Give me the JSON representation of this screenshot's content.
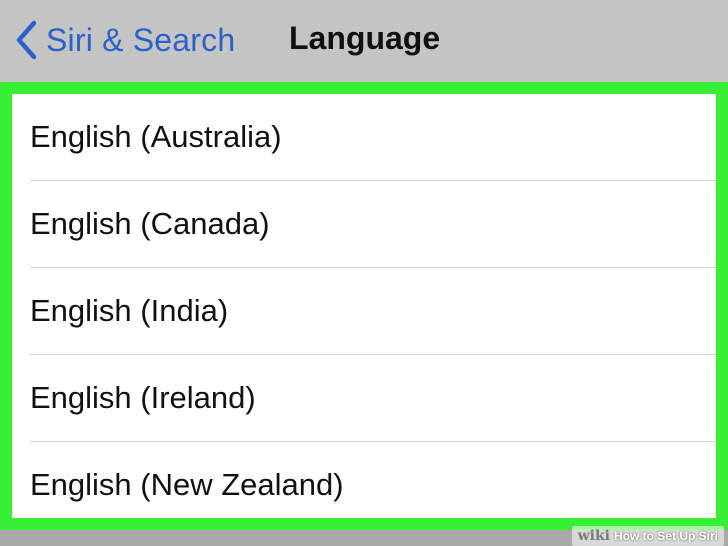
{
  "navbar": {
    "back_label": "Siri & Search",
    "title": "Language",
    "back_icon": "chevron-left-icon",
    "accent_color": "#2a62c9"
  },
  "languages": [
    {
      "label": "English (Australia)"
    },
    {
      "label": "English (Canada)"
    },
    {
      "label": "English (India)"
    },
    {
      "label": "English (Ireland)"
    },
    {
      "label": "English (New Zealand)"
    }
  ],
  "highlight_color": "#39ef35",
  "watermark": {
    "logo": "wiki",
    "text": "How to Set Up Siri"
  }
}
